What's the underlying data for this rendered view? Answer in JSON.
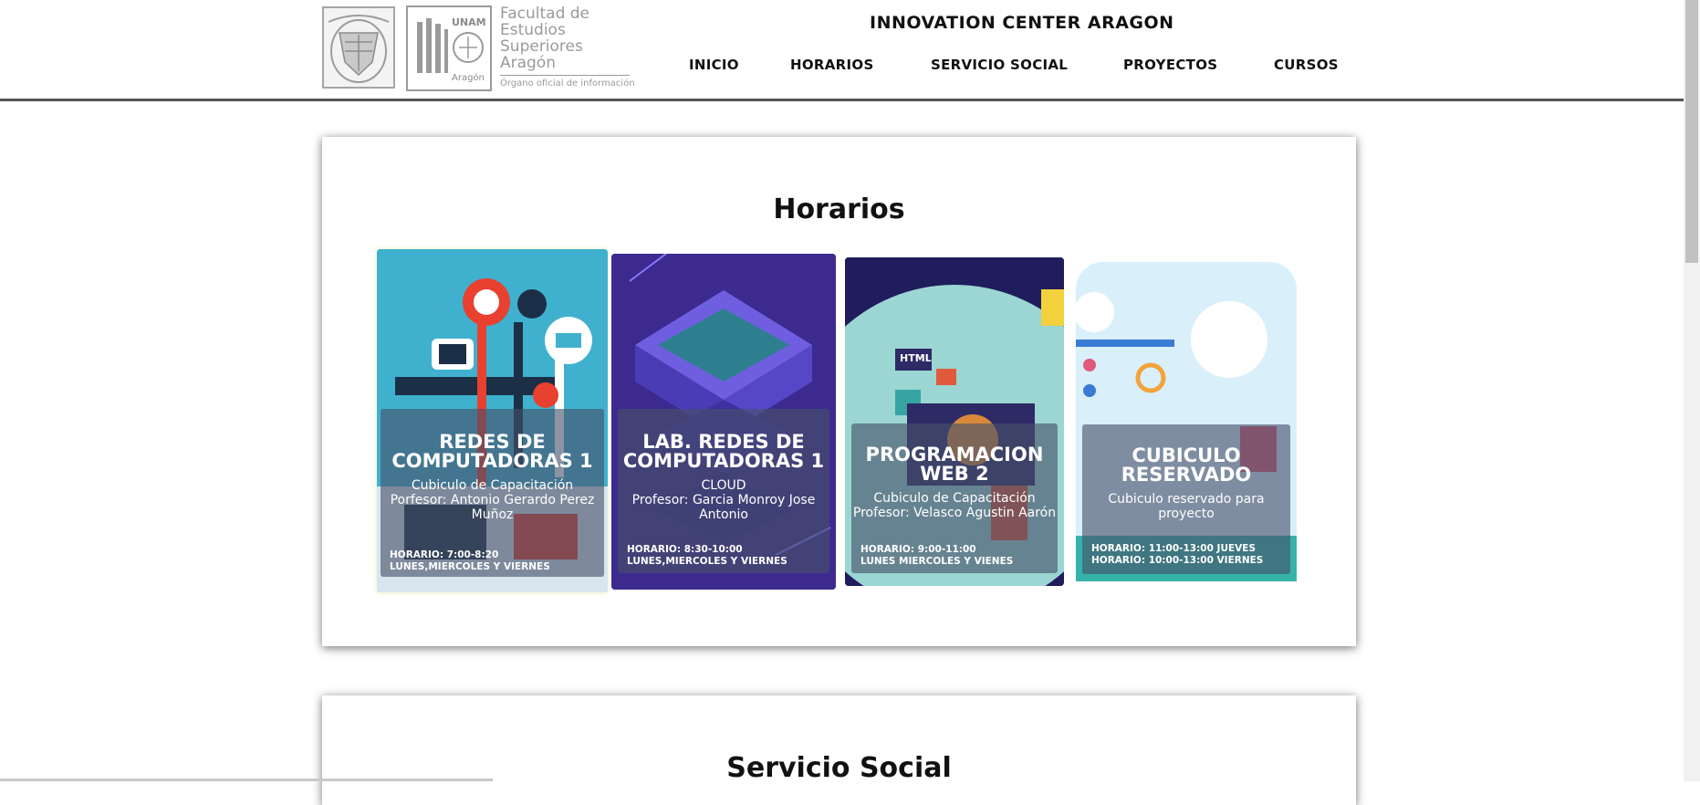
{
  "header": {
    "faculty_lines": [
      "Facultad de",
      "Estudios",
      "Superiores",
      "Aragón"
    ],
    "faculty_sub": "Órgano oficial de información",
    "seal_text": "UNAM",
    "seal_text2": "Aragón",
    "site_title": "INNOVATION CENTER ARAGON",
    "nav": [
      "INICIO",
      "HORARIOS",
      "SERVICIO SOCIAL",
      "PROYECTOS",
      "CURSOS"
    ]
  },
  "horarios": {
    "title": "Horarios",
    "cards": [
      {
        "title": "REDES DE COMPUTADORAS 1",
        "subtitle": "Cubiculo de Capacitación\nPorfesor: Antonio Gerardo Perez Muñoz",
        "hours": "HORARIO: 7:00-8:20\nLUNES,MIERCOLES Y VIERNES"
      },
      {
        "title": "LAB. REDES DE COMPUTADORAS 1",
        "subtitle": "CLOUD\nProfesor: Garcia Monroy Jose Antonio",
        "hours": "HORARIO: 8:30-10:00\nLUNES,MIERCOLES Y VIERNES"
      },
      {
        "title": "PROGRAMACION WEB 2",
        "subtitle": "Cubiculo de Capacitación\nProfesor: Velasco Agustin Aarón",
        "hours": "HORARIO: 9:00-11:00\nLUNES MIERCOLES Y VIENES",
        "icon_label": "HTML"
      },
      {
        "title": "CUBICULO RESERVADO",
        "subtitle": "Cubiculo reservado para proyecto",
        "hours": "HORARIO: 11:00-13:00 JUEVES\nHORARIO: 10:00-13:00 VIERNES"
      }
    ]
  },
  "servicio": {
    "title": "Servicio Social"
  },
  "colors": {
    "card1_bg": "#3fb1cf",
    "card2_bg": "#3d2a8f",
    "card3_bg": "#1f1d5c",
    "card4_bg": "#d9f0fb"
  }
}
